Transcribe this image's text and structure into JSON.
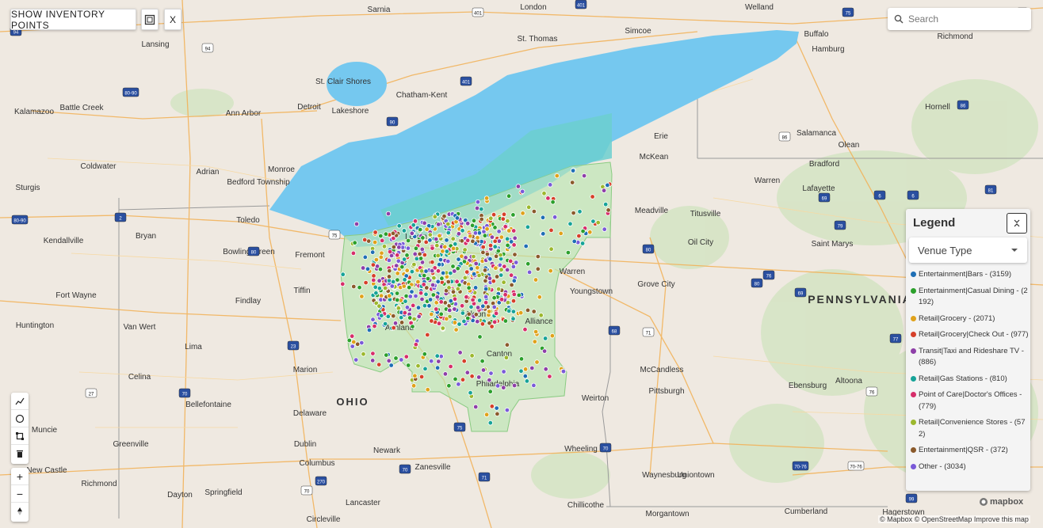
{
  "toolbar": {
    "show_inventory_label": "SHOW INVENTORY POINTS",
    "close_label": "X"
  },
  "search": {
    "placeholder": "Search"
  },
  "legend": {
    "title": "Legend",
    "dropdown_value": "Venue Type",
    "items": [
      {
        "label": "Entertainment|Bars - (3159)",
        "color": "#1f6fb5"
      },
      {
        "label": "Entertainment|Casual Dining - (2192)",
        "color": "#2ca02c"
      },
      {
        "label": "Retail|Grocery - (2071)",
        "color": "#e0a21b"
      },
      {
        "label": "Retail|Grocery|Check Out - (977)",
        "color": "#d6402a"
      },
      {
        "label": "Transit|Taxi and Rideshare TV - (886)",
        "color": "#8e3fa8"
      },
      {
        "label": "Retail|Gas Stations - (810)",
        "color": "#17a398"
      },
      {
        "label": "Point of Care|Doctor's Offices - (779)",
        "color": "#d62e6a"
      },
      {
        "label": "Retail|Convenience Stores - (572)",
        "color": "#9cb82e"
      },
      {
        "label": "Entertainment|QSR - (372)",
        "color": "#8b5a2b"
      },
      {
        "label": "Other - (3034)",
        "color": "#7a5ad8"
      }
    ]
  },
  "attribution": "© Mapbox © OpenStreetMap  Improve this map",
  "mapbox_logo": "mapbox",
  "map_labels": {
    "states": [
      "OHIO",
      "PENNSYLVANIA"
    ],
    "cities": [
      "Sarnia",
      "London",
      "Welland",
      "Buffalo",
      "Richmond",
      "Lansing",
      "St. Thomas",
      "Simcoe",
      "Hamburg",
      "St. Clair Shores",
      "Chatham-Kent",
      "Detroit",
      "Lakeshore",
      "Kalamazoo",
      "Battle Creek",
      "Ann Arbor",
      "Erie",
      "Salamanca",
      "Hornell",
      "Olean",
      "Coldwater",
      "Adrian",
      "Monroe",
      "McKean",
      "Bradford",
      "Sturgis",
      "Bedford Township",
      "Warren",
      "Lafayette",
      "Toledo",
      "Meadville",
      "Titusville",
      "Bryan",
      "Kendallville",
      "Bowling Green",
      "Fremont",
      "Oil City",
      "Saint Marys",
      "Lorain",
      "Warren",
      "Grove City",
      "Fort Wayne",
      "Tiffin",
      "Findlay",
      "Youngstown",
      "Huntington",
      "Van Wert",
      "Ashland",
      "Alliance",
      "Lima",
      "McCandless",
      "Pittsburgh",
      "Celina",
      "Marion",
      "Ebensburg",
      "Altoona",
      "Bellefontaine",
      "Delaware",
      "Weirton",
      "Muncie",
      "Dublin",
      "Newark",
      "Columbus",
      "Wheeling",
      "New Castle",
      "Richmond",
      "Greenville",
      "Springfield",
      "Zanesville",
      "Waynesburg",
      "Uniontown",
      "Dayton",
      "Lancaster",
      "Chillicothe",
      "Cumberland",
      "Hagerstown",
      "Circleville",
      "Morgantown",
      "Philadelphia",
      "Canton",
      "Akron"
    ]
  },
  "highway_shields": [
    "401",
    "401",
    "401",
    "90",
    "75",
    "94",
    "94",
    "80-90",
    "80-90",
    "2",
    "75",
    "80",
    "76",
    "79",
    "80",
    "71",
    "23",
    "70",
    "70",
    "71",
    "70",
    "75",
    "69",
    "69",
    "80",
    "86",
    "86",
    "6",
    "6",
    "70-76",
    "70-76",
    "99",
    "99",
    "81",
    "270",
    "27",
    "68",
    "70",
    "77",
    "81",
    "76",
    "90"
  ]
}
